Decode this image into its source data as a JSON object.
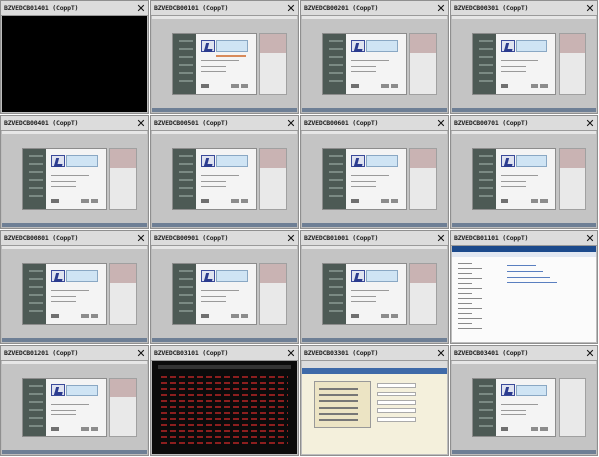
{
  "tiles": [
    {
      "name": "BZVEDCB01401 (CoppT)",
      "screen": "black"
    },
    {
      "name": "BZVEDCB00101 (CoppT)",
      "screen": "login-alert"
    },
    {
      "name": "BZVEDCB00201 (CoppT)",
      "screen": "login"
    },
    {
      "name": "BZVEDCB00301 (CoppT)",
      "screen": "login"
    },
    {
      "name": "BZVEDCB00401 (CoppT)",
      "screen": "login"
    },
    {
      "name": "BZVEDCB00501 (CoppT)",
      "screen": "login"
    },
    {
      "name": "BZVEDCB00601 (CoppT)",
      "screen": "login"
    },
    {
      "name": "BZVEDCB00701 (CoppT)",
      "screen": "login"
    },
    {
      "name": "BZVEDCB00801 (CoppT)",
      "screen": "login"
    },
    {
      "name": "BZVEDCB00901 (CoppT)",
      "screen": "login"
    },
    {
      "name": "BZVEDCB01001 (CoppT)",
      "screen": "login"
    },
    {
      "name": "BZVEDCB01101 (CoppT)",
      "screen": "document"
    },
    {
      "name": "BZVEDCB01201 (CoppT)",
      "screen": "login"
    },
    {
      "name": "BZVEDCB03101 (CoppT)",
      "screen": "terminal"
    },
    {
      "name": "BZVEDCB03301 (CoppT)",
      "screen": "sap"
    },
    {
      "name": "BZVEDCB03401 (CoppT)",
      "screen": "login-white"
    }
  ],
  "close_glyph": "✕",
  "close_icon": "close-icon",
  "colors": {
    "titlebar": "#dcdcdc",
    "tile_bg": "#bdbdbd",
    "terminal_text": "#a32222",
    "doc_header": "#1c4a8c"
  }
}
